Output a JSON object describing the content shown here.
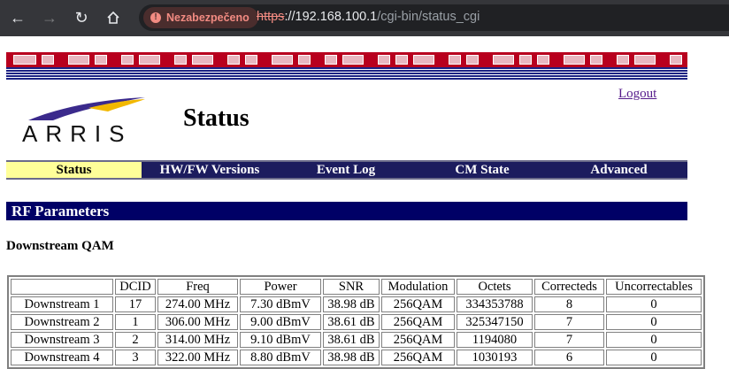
{
  "browser": {
    "security_label": "Nezabezpečeno",
    "url_scheme": "https",
    "url_host": "://192.168.100.1",
    "url_path": "/cgi-bin/status_cgi"
  },
  "header": {
    "logout": "Logout",
    "logo_text": "ARRIS",
    "title": "Status"
  },
  "menu": {
    "items": [
      {
        "label": "Status",
        "active": true
      },
      {
        "label": "HW/FW Versions"
      },
      {
        "label": "Event Log"
      },
      {
        "label": "CM State"
      },
      {
        "label": "Advanced"
      }
    ]
  },
  "section": {
    "title": "RF Parameters",
    "subtitle": "Downstream QAM"
  },
  "table": {
    "headers": [
      "",
      "DCID",
      "Freq",
      "Power",
      "SNR",
      "Modulation",
      "Octets",
      "Correcteds",
      "Uncorrectables"
    ],
    "rows": [
      [
        "Downstream 1",
        "17",
        "274.00 MHz",
        "7.30 dBmV",
        "38.98 dB",
        "256QAM",
        "334353788",
        "8",
        "0"
      ],
      [
        "Downstream 2",
        "1",
        "306.00 MHz",
        "9.00 dBmV",
        "38.61 dB",
        "256QAM",
        "325347150",
        "7",
        "0"
      ],
      [
        "Downstream 3",
        "2",
        "314.00 MHz",
        "9.10 dBmV",
        "38.61 dB",
        "256QAM",
        "1194080",
        "7",
        "0"
      ],
      [
        "Downstream 4",
        "3",
        "322.00 MHz",
        "8.80 dBmV",
        "38.98 dB",
        "256QAM",
        "1030193",
        "6",
        "0"
      ]
    ]
  },
  "colors": {
    "banner_red": "#b8001e",
    "nav_blue": "#1c1c5e",
    "section_blue": "#000066",
    "active_tab": "#ffff99"
  }
}
